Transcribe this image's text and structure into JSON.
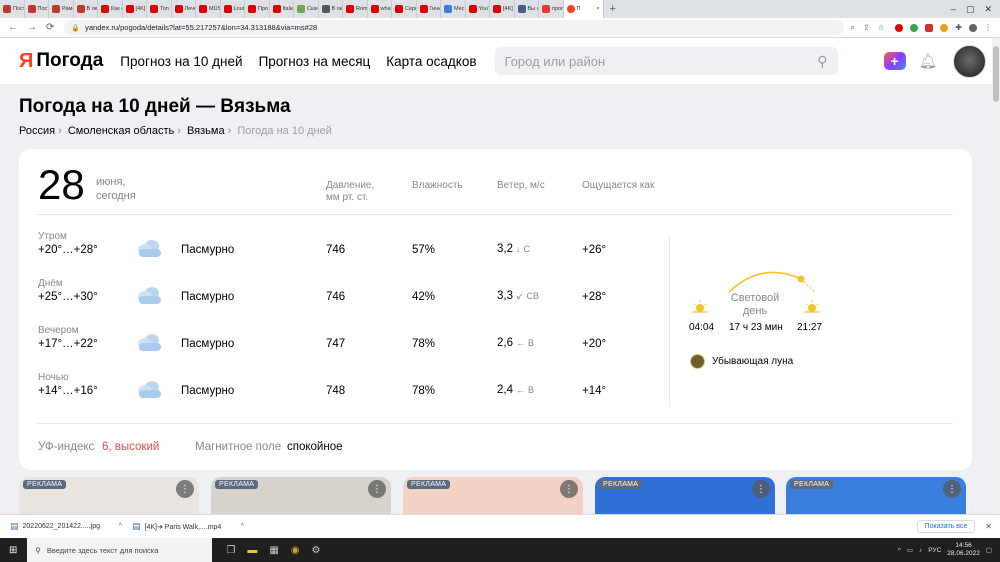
{
  "browser": {
    "tabs": [
      {
        "label": "Пост",
        "color": "#c0392b"
      },
      {
        "label": "Пост",
        "color": "#c0392b"
      },
      {
        "label": "Рамс",
        "color": "#c0392b"
      },
      {
        "label": "В ок",
        "color": "#c0392b"
      },
      {
        "label": "Как с",
        "color": "#e00000"
      },
      {
        "label": "[4K] ",
        "color": "#e00000"
      },
      {
        "label": "Ton ",
        "color": "#e00000"
      },
      {
        "label": "Лечс",
        "color": "#e00000"
      },
      {
        "label": "MÜS",
        "color": "#e00000"
      },
      {
        "label": "Louri",
        "color": "#e00000"
      },
      {
        "label": "Про",
        "color": "#e00000"
      },
      {
        "label": "Italia",
        "color": "#e00000"
      },
      {
        "label": "Скач",
        "color": "#6aa84f"
      },
      {
        "label": "В ок",
        "color": "#555555"
      },
      {
        "label": "Rom",
        "color": "#e00000"
      },
      {
        "label": "what",
        "color": "#e00000"
      },
      {
        "label": "Сери",
        "color": "#e00000"
      },
      {
        "label": "Гини",
        "color": "#e00000"
      },
      {
        "label": "Мес",
        "color": "#3d7be0"
      },
      {
        "label": "YouT",
        "color": "#e00000"
      },
      {
        "label": "[4K]",
        "color": "#e00000"
      },
      {
        "label": "Вы н",
        "color": "#4a5b8c"
      },
      {
        "label": "прог",
        "color": "#e53935"
      }
    ],
    "active_tab": {
      "label": "П",
      "color": "#fc3f1d"
    },
    "new_tab": "+",
    "url": "yandex.ru/pogoda/details?lat=55.217257&lon=34.313188&via=ms#28"
  },
  "header": {
    "logo_ya": "Я",
    "logo_text": "Погода",
    "nav": [
      "Прогноз на 10 дней",
      "Прогноз на месяц",
      "Карта осадков"
    ],
    "search_placeholder": "Город или район"
  },
  "title": "Погода на 10 дней — Вязьма",
  "breadcrumb": [
    "Россия",
    "Смоленская область",
    "Вязьма",
    "Погода на 10 дней"
  ],
  "forecast": {
    "day": "28",
    "month": "июня,",
    "day_label": "сегодня",
    "columns": {
      "pressure": "Давление,",
      "pressure_unit": "мм рт. ст.",
      "humidity": "Влажность",
      "wind": "Ветер, м/с",
      "feels": "Ощущается как"
    },
    "rows": [
      {
        "period": "Утром",
        "temp": "+20°…+28°",
        "condition": "Пасмурно",
        "pressure": "746",
        "humidity": "57%",
        "wind": "3,2",
        "wind_dir": "С",
        "wind_arrow": "↓",
        "feels": "+26°"
      },
      {
        "period": "Днём",
        "temp": "+25°…+30°",
        "condition": "Пасмурно",
        "pressure": "746",
        "humidity": "42%",
        "wind": "3,3",
        "wind_dir": "СВ",
        "wind_arrow": "↙",
        "feels": "+28°"
      },
      {
        "period": "Вечером",
        "temp": "+17°…+22°",
        "condition": "Пасмурно",
        "pressure": "747",
        "humidity": "78%",
        "wind": "2,6",
        "wind_dir": "В",
        "wind_arrow": "←",
        "feels": "+20°"
      },
      {
        "period": "Ночью",
        "temp": "+14°…+16°",
        "condition": "Пасмурно",
        "pressure": "748",
        "humidity": "78%",
        "wind": "2,4",
        "wind_dir": "В",
        "wind_arrow": "←",
        "feels": "+14°"
      }
    ],
    "sun": {
      "label_line1": "Световой",
      "label_line2": "день",
      "sunrise": "04:04",
      "daylength": "17 ч 23 мин",
      "sunset": "21:27"
    },
    "moon": "Убывающая луна",
    "uv_label": "УФ-индекс",
    "uv_value": "6, высокий",
    "magnetic_label": "Магнитное поле",
    "magnetic_value": "спокойное"
  },
  "ads": {
    "badge": "РЕКЛАМА",
    "items": [
      {
        "bg": "#e9e4df"
      },
      {
        "bg": "#d8d2cc"
      },
      {
        "bg": "#f2d2c4"
      },
      {
        "bg": "#2f6fd6"
      },
      {
        "bg": "#3a7fe0"
      }
    ]
  },
  "downloads": {
    "items": [
      "20220622_201422.....jpg",
      "[4K]➔ Paris Walk,....mp4"
    ],
    "show_all": "Показать все"
  },
  "taskbar": {
    "search_placeholder": "Введите здесь текст для поиска",
    "lang": "РУС",
    "time": "14:56",
    "date": "28.06.2022"
  }
}
